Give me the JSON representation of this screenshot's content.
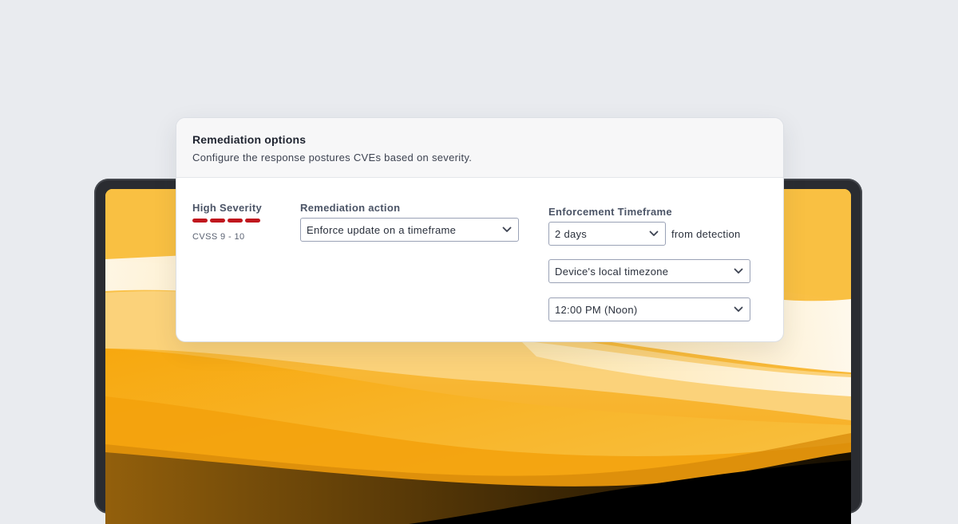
{
  "card": {
    "title": "Remediation options",
    "subtitle": "Configure the response postures CVEs based on severity."
  },
  "severity": {
    "label": "High Severity",
    "cvss": "CVSS 9 - 10",
    "level": 4,
    "level_max": 4,
    "color": "#c0171d"
  },
  "remediation": {
    "label": "Remediation action",
    "selected": "Enforce update on a timeframe"
  },
  "enforcement": {
    "label": "Enforcement Timeframe",
    "days_selected": "2 days",
    "days_suffix": "from detection",
    "timezone_selected": "Device's local timezone",
    "time_selected": "12:00 PM (Noon)"
  },
  "icons": {
    "select_chevron": "chevron-down-icon"
  },
  "colors": {
    "page_background": "#e9ebef",
    "laptop_bezel": "#2a2c31",
    "wallpaper_accent": "#f6b21c"
  }
}
